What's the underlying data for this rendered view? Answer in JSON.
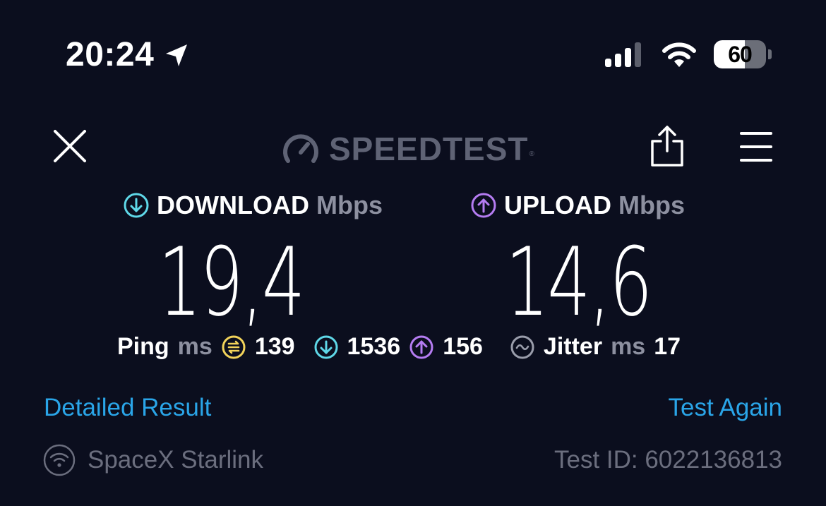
{
  "status_bar": {
    "time": "20:24",
    "battery_level": "60",
    "battery_fraction": 0.6,
    "icons": [
      "location-arrow-icon",
      "cellular-signal-icon",
      "wifi-icon",
      "battery-icon"
    ]
  },
  "header": {
    "logo_text": "SPEEDTEST",
    "logo_mark": "®",
    "icons": [
      "close-icon",
      "gauge-icon",
      "share-icon",
      "menu-icon"
    ]
  },
  "download": {
    "label": "DOWNLOAD",
    "unit": "Mbps",
    "value": "19,4",
    "icon": "download-arrow-icon",
    "color": "#5fd8e8"
  },
  "upload": {
    "label": "UPLOAD",
    "unit": "Mbps",
    "value": "14,6",
    "icon": "upload-arrow-icon",
    "color": "#b57cf2"
  },
  "ping": {
    "label": "Ping",
    "unit": "ms",
    "idle": "139",
    "download": "1536",
    "upload": "156",
    "idle_color": "#f2d35a",
    "icons": [
      "idle-latency-icon",
      "download-latency-icon",
      "upload-latency-icon",
      "jitter-icon"
    ]
  },
  "jitter": {
    "label": "Jitter",
    "unit": "ms",
    "value": "17"
  },
  "links": {
    "detailed": "Detailed Result",
    "again": "Test Again",
    "color": "#2aa5e8"
  },
  "footer": {
    "provider": "SpaceX Starlink",
    "test_id": "Test ID: 6022136813"
  }
}
